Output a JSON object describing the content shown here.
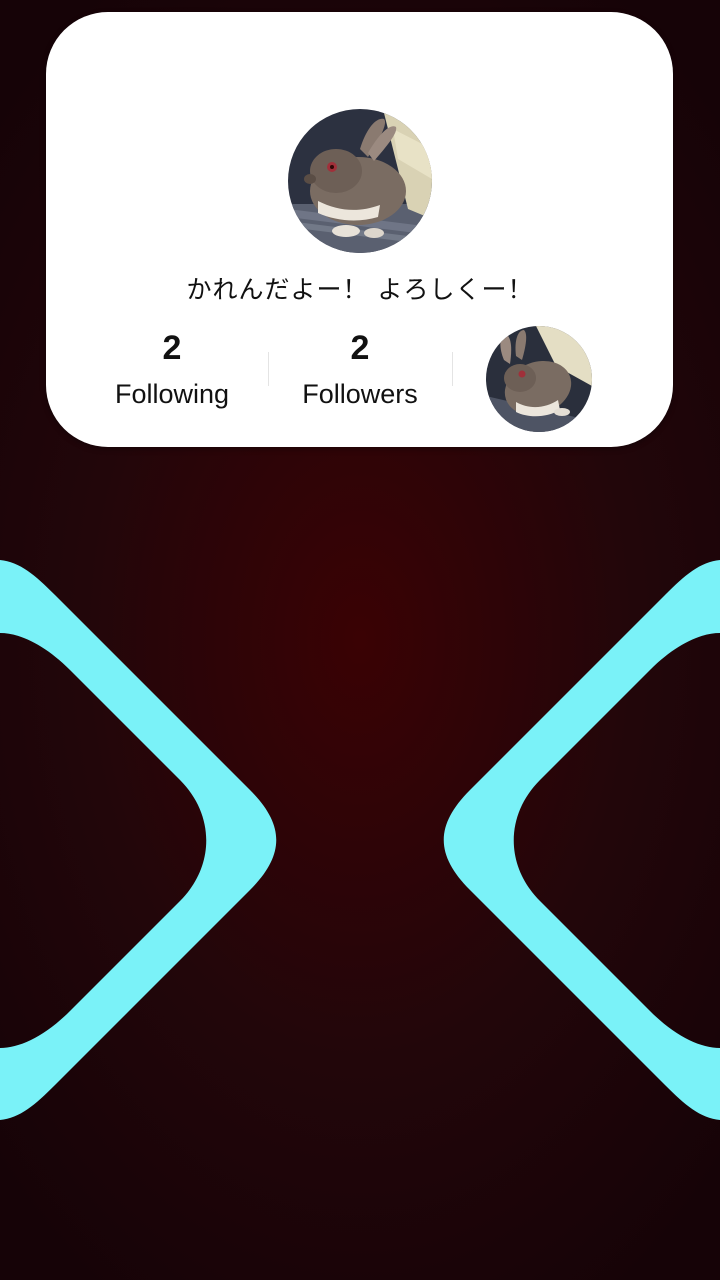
{
  "profile": {
    "bio": "かれんだよー！ よろしくー！",
    "following_count": "2",
    "following_label": "Following",
    "followers_count": "2",
    "followers_label": "Followers"
  },
  "colors": {
    "card_background": "#ffffff",
    "accent_cyan": "#7af2f8",
    "background_dark": "#2a0206"
  },
  "icons": {
    "left_shape": "chevron-right-shape",
    "right_shape": "chevron-left-shape"
  }
}
